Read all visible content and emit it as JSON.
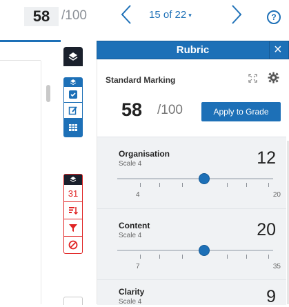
{
  "topbar": {
    "grade_value": "58",
    "grade_total": "/100",
    "page_indicator": "15 of 22",
    "caret": "▾",
    "prev_icon": "chevron-left-icon",
    "next_icon": "chevron-right-icon",
    "help_label": "?"
  },
  "toolbar": {
    "layers_icon": "layers-icon",
    "group1_icons": [
      "check-box-icon",
      "edit-icon",
      "grid-icon"
    ],
    "group2": {
      "calendar_label": "31",
      "icons": [
        "sort-descending-icon",
        "filter-icon",
        "block-icon"
      ]
    }
  },
  "rubric": {
    "title": "Rubric",
    "close_label": "×",
    "standard_marking_label": "Standard Marking",
    "score_value": "58",
    "score_total": "/100",
    "apply_button_label": "Apply to Grade",
    "criteria": [
      {
        "name": "Organisation",
        "scale": "Scale 4",
        "score": "12",
        "min": "4",
        "max": "20",
        "level": 0.5
      },
      {
        "name": "Content",
        "scale": "Scale 4",
        "score": "20",
        "min": "7",
        "max": "35",
        "level": 0.5
      },
      {
        "name": "Clarity",
        "scale": "Scale 4",
        "score": "9"
      }
    ]
  },
  "colors": {
    "accent": "#1d70b7",
    "toolbar_dark": "#1a202c",
    "danger": "#e02424",
    "panel_bg": "#f0f2f4"
  }
}
